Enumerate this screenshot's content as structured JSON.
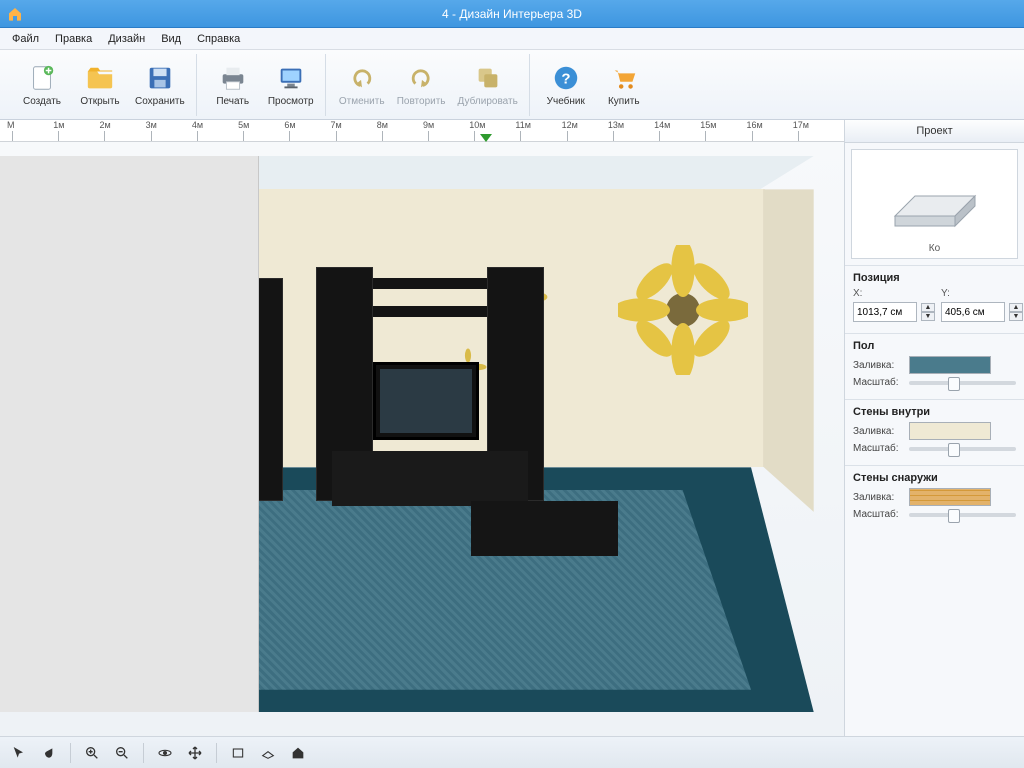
{
  "window": {
    "title": "4 - Дизайн Интерьера 3D"
  },
  "menu": {
    "file": "Файл",
    "edit": "Правка",
    "design": "Дизайн",
    "view": "Вид",
    "help": "Справка"
  },
  "toolbar": {
    "create": "Создать",
    "open": "Открыть",
    "save": "Сохранить",
    "print": "Печать",
    "preview": "Просмотр",
    "undo": "Отменить",
    "redo": "Повторить",
    "duplicate": "Дублировать",
    "tutorial": "Учебник",
    "buy": "Купить"
  },
  "ruler": {
    "ticks": [
      "М",
      "1м",
      "2м",
      "3м",
      "4м",
      "5м",
      "6м",
      "7м",
      "8м",
      "9м",
      "10м",
      "11м",
      "12м",
      "13м",
      "14м",
      "15м",
      "16м",
      "17м"
    ]
  },
  "side": {
    "tab_project": "Проект",
    "preview_caption": "Ко",
    "position": {
      "title": "Позиция",
      "x_label": "X:",
      "y_label": "Y:",
      "x_value": "1013,7 см",
      "y_value": "405,6 см"
    },
    "floor": {
      "title": "Пол",
      "fill": "Заливка:",
      "scale": "Масштаб:"
    },
    "walls_in": {
      "title": "Стены внутри",
      "fill": "Заливка:",
      "scale": "Масштаб:"
    },
    "walls_out": {
      "title": "Стены снаружи",
      "fill": "Заливка:",
      "scale": "Масштаб:"
    }
  },
  "statusbar": {
    "pointer": "pointer",
    "pan": "pan",
    "zoomin": "zoom-in",
    "zoomout": "zoom-out",
    "orbit": "orbit",
    "move": "move",
    "front": "front-view",
    "top": "top-view",
    "home": "home-view"
  }
}
